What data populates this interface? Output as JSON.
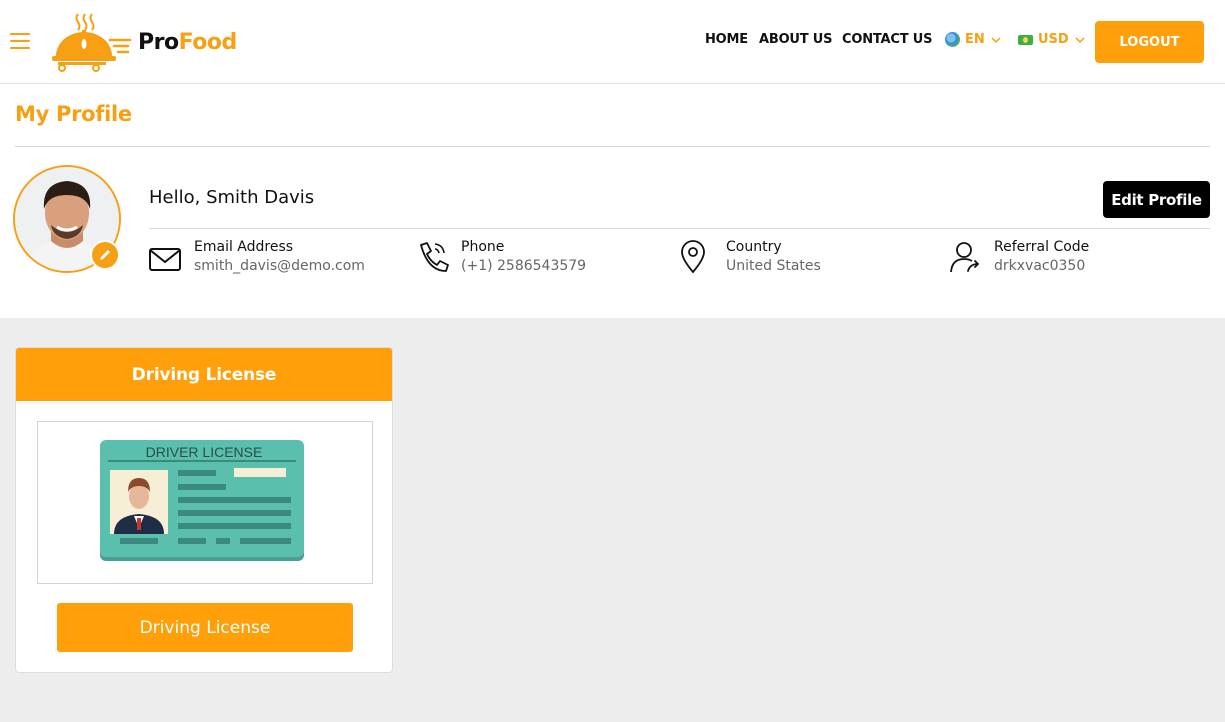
{
  "header": {
    "logo": {
      "pro": "Pro",
      "food": "Food"
    },
    "nav": {
      "home": "HOME",
      "about": "ABOUT US",
      "contact": "CONTACT US"
    },
    "language": "EN",
    "currency": "USD",
    "logout_label": "LOGOUT"
  },
  "profile": {
    "title": "My Profile",
    "greeting": "Hello, Smith Davis",
    "edit_label": "Edit Profile",
    "email": {
      "label": "Email Address",
      "value": "smith_davis@demo.com"
    },
    "phone": {
      "label": "Phone",
      "value": "(+1) 2586543579"
    },
    "country": {
      "label": "Country",
      "value": "United States"
    },
    "referral": {
      "label": "Referral Code",
      "value": "drkxvac0350"
    }
  },
  "document": {
    "header": "Driving License",
    "image_text": "DRIVER LICENSE",
    "button_label": "Driving License"
  },
  "colors": {
    "accent": "#ff9f0a",
    "license_card": "#5bbfae",
    "dark": "#000000"
  }
}
